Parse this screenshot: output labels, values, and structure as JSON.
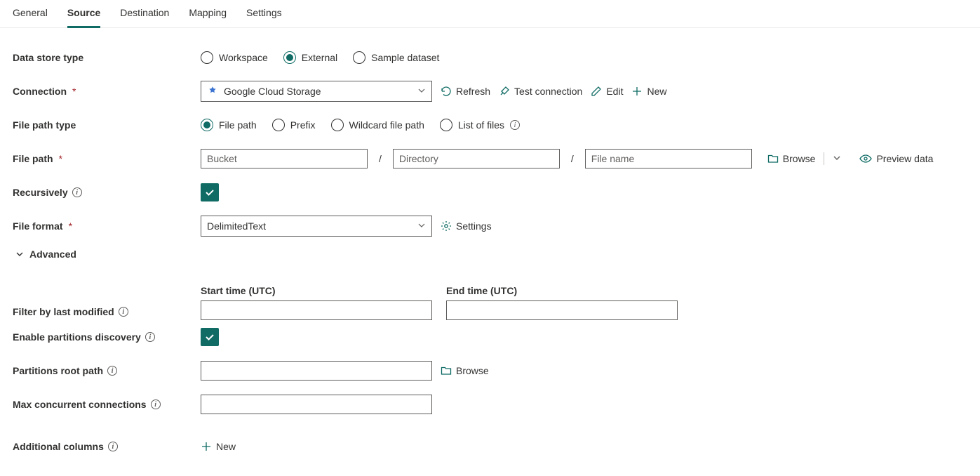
{
  "tabs": {
    "general": "General",
    "source": "Source",
    "destination": "Destination",
    "mapping": "Mapping",
    "settings": "Settings"
  },
  "labels": {
    "data_store_type": "Data store type",
    "connection": "Connection",
    "file_path_type": "File path type",
    "file_path": "File path",
    "recursively": "Recursively",
    "file_format": "File format",
    "advanced": "Advanced",
    "start_time": "Start time (UTC)",
    "end_time": "End time (UTC)",
    "filter_by_last_modified": "Filter by last modified",
    "enable_partitions_discovery": "Enable partitions discovery",
    "partitions_root_path": "Partitions root path",
    "max_concurrent_connections": "Max concurrent connections",
    "additional_columns": "Additional columns"
  },
  "data_store_type_options": {
    "workspace": "Workspace",
    "external": "External",
    "sample": "Sample dataset"
  },
  "connection": {
    "value": "Google Cloud Storage",
    "refresh": "Refresh",
    "test": "Test connection",
    "edit": "Edit",
    "new": "New"
  },
  "file_path_type_options": {
    "file_path": "File path",
    "prefix": "Prefix",
    "wildcard": "Wildcard file path",
    "list_of_files": "List of files"
  },
  "file_path": {
    "bucket_ph": "Bucket",
    "directory_ph": "Directory",
    "filename_ph": "File name",
    "browse": "Browse",
    "preview": "Preview data"
  },
  "file_format": {
    "value": "DelimitedText",
    "settings": "Settings"
  },
  "partitions": {
    "browse": "Browse"
  },
  "additional_columns": {
    "new": "New"
  }
}
